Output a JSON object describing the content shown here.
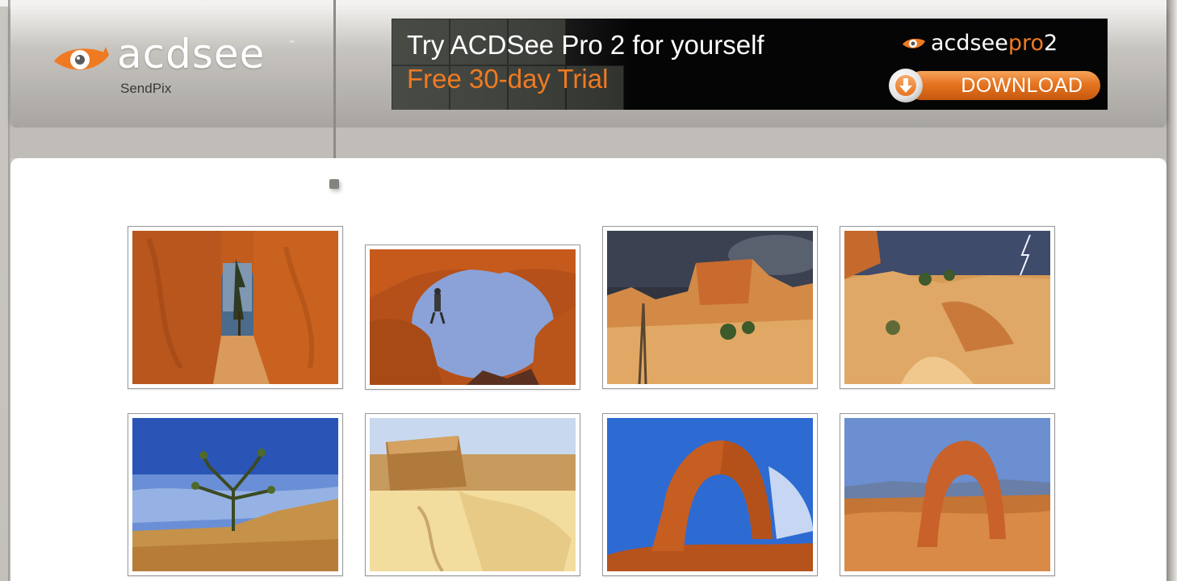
{
  "app": {
    "logo_word": "acdsee",
    "logo_tm": "™",
    "logo_sub": "SendPix"
  },
  "banner": {
    "title": "Try ACDSee Pro 2 for yourself",
    "subtitle": "Free 30-day Trial",
    "product_word": "acdsee",
    "product_pro": "pro",
    "product_ver": "2",
    "download_label": "DOWNLOAD"
  },
  "gallery": {
    "photos": [
      {
        "icon": "canyon-tunnel-photo"
      },
      {
        "icon": "hiker-arch-photo"
      },
      {
        "icon": "hoodoo-storm-photo"
      },
      {
        "icon": "canyon-lightning-photo"
      },
      {
        "icon": "joshua-tree-photo"
      },
      {
        "icon": "mesa-rock-photo"
      },
      {
        "icon": "delicate-arch-blue-sky-photo"
      },
      {
        "icon": "delicate-arch-mountains-photo"
      }
    ]
  },
  "colors": {
    "accent": "#f07a22",
    "header_top": "#f1f0ee",
    "header_bottom": "#a8a5a0",
    "banner_bg": "#050505"
  }
}
